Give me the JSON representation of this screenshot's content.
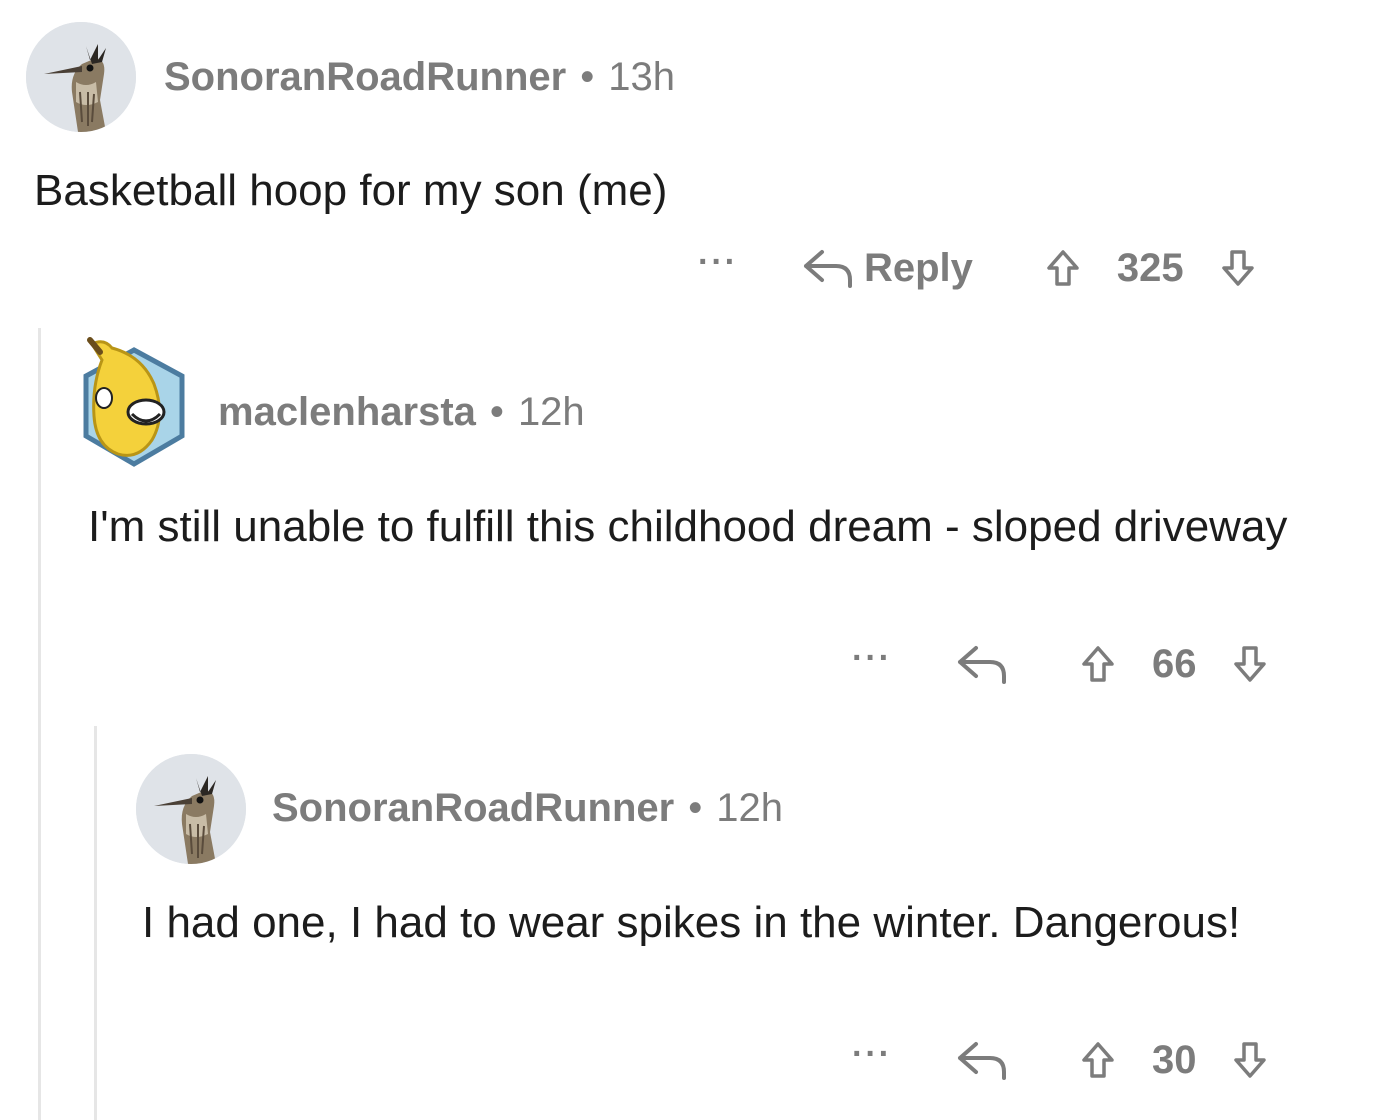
{
  "comments": [
    {
      "username": "SonoranRoadRunner",
      "separator": "•",
      "time": "13h",
      "body": "Basketball hoop for my son (me)",
      "reply_label": "Reply",
      "score": "325"
    },
    {
      "username": "maclenharsta",
      "separator": "•",
      "time": "12h",
      "body": "I'm still unable to fulfill this childhood dream - sloped driveway",
      "score": "66"
    },
    {
      "username": "SonoranRoadRunner",
      "separator": "•",
      "time": "12h",
      "body": "I had one, I had to wear spikes in the winter. Dangerous!",
      "score": "30"
    }
  ],
  "icons": {
    "more": "more-options-icon",
    "reply": "reply-arrow-icon",
    "upvote": "upvote-arrow-icon",
    "downvote": "downvote-arrow-icon"
  },
  "colors": {
    "meta_text": "#7c7c7c",
    "body_text": "#1c1c1c",
    "thread_line": "#e6e6e6"
  }
}
